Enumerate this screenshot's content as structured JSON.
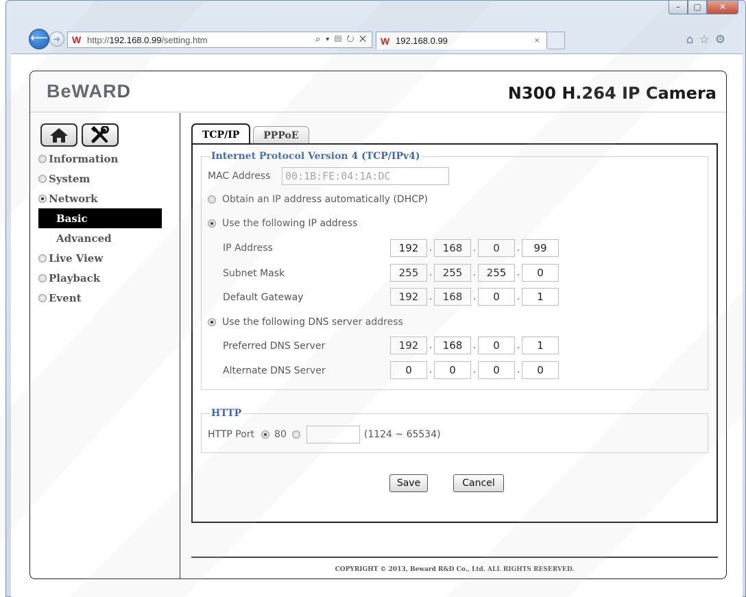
{
  "browser": {
    "url_prefix": "http://",
    "url_host": "192.168.0.99",
    "url_path": "/setting.htm",
    "address_tools": "⌕ ▾ ▤ ↻ ✕",
    "tab_title": "192.168.0.99",
    "tab_close": "×",
    "window_buttons": [
      "–",
      "▢",
      "✕"
    ],
    "toolbar_icons": [
      "⌂",
      "☆",
      "⚙"
    ]
  },
  "header": {
    "logo": "BeWARD",
    "model": "N300 H.264 IP Camera"
  },
  "sidebar": {
    "items": [
      {
        "label": "Information",
        "selected": false
      },
      {
        "label": "System",
        "selected": false
      },
      {
        "label": "Network",
        "selected": true
      },
      {
        "label": "Live View",
        "selected": false
      },
      {
        "label": "Playback",
        "selected": false
      },
      {
        "label": "Event",
        "selected": false
      }
    ],
    "subitems": [
      {
        "label": "Basic",
        "active": true
      },
      {
        "label": "Advanced",
        "active": false
      }
    ]
  },
  "tabs": [
    {
      "label": "TCP/IP",
      "active": true
    },
    {
      "label": "PPPoE",
      "active": false
    }
  ],
  "ipv4": {
    "legend": "Internet Protocol Version 4 (TCP/IPv4)",
    "mac_label": "MAC Address",
    "mac_value": "00:1B:FE:04:1A:DC",
    "dhcp_label": "Obtain an IP address automatically (DHCP)",
    "static_label": "Use the following IP address",
    "ip_label": "IP Address",
    "ip": [
      "192",
      "168",
      "0",
      "99"
    ],
    "mask_label": "Subnet Mask",
    "mask": [
      "255",
      "255",
      "255",
      "0"
    ],
    "gateway_label": "Default Gateway",
    "gateway": [
      "192",
      "168",
      "0",
      "1"
    ],
    "dns_label": "Use the following DNS server address",
    "pdns_label": "Preferred DNS Server",
    "pdns": [
      "192",
      "168",
      "0",
      "1"
    ],
    "adns_label": "Alternate DNS Server",
    "adns": [
      "0",
      "0",
      "0",
      "0"
    ],
    "separator": "."
  },
  "http": {
    "legend": "HTTP",
    "port_label": "HTTP Port",
    "default_port": "80",
    "custom_port": "",
    "range": "(1124 ~ 65534)"
  },
  "actions": {
    "save": "Save",
    "cancel": "Cancel"
  },
  "footer": {
    "copyright": "COPYRIGHT © 2013, Beward R&D Co., Ltd. ALL RIGHTS RESERVED."
  }
}
